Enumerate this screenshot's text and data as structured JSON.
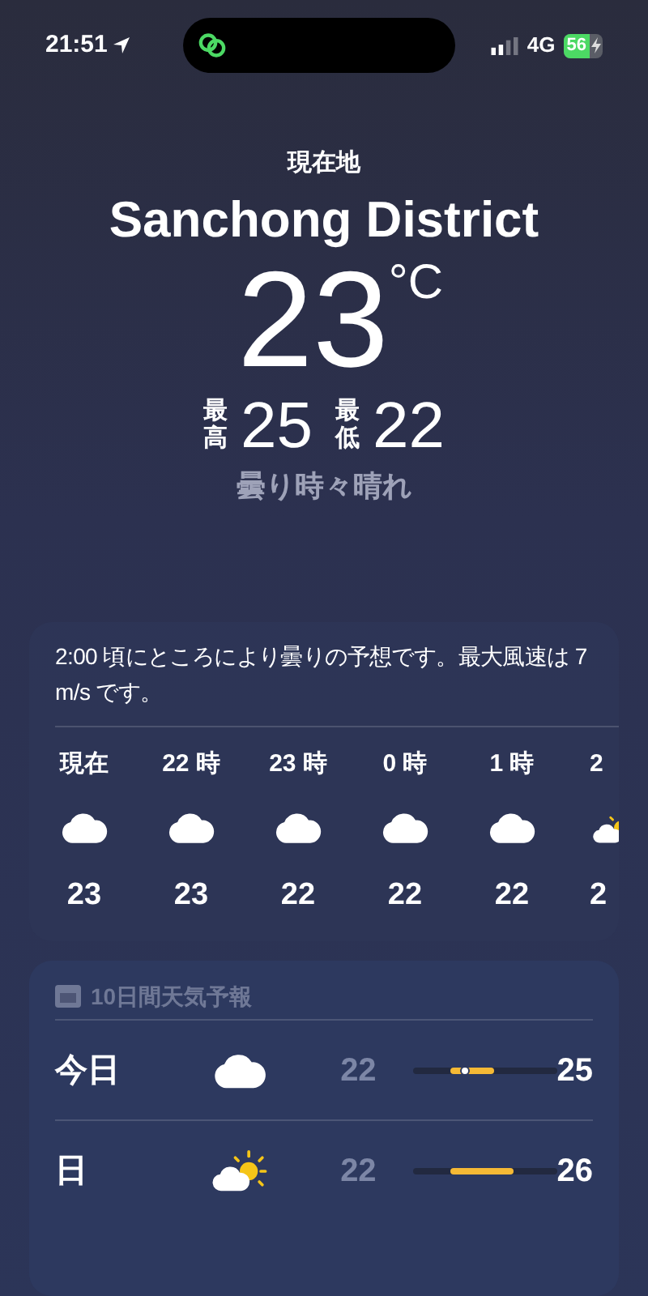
{
  "status_bar": {
    "time": "21:51",
    "network": "4G",
    "battery": "56"
  },
  "header": {
    "location_label": "現在地",
    "city": "Sanchong District",
    "temperature": "23",
    "unit": "°C",
    "high_label": "最高",
    "high": "25",
    "low_label": "最低",
    "low": "22",
    "condition": "曇り時々晴れ"
  },
  "hourly": {
    "summary": "2:00 頃にところにより曇りの予想です。最大風速は 7 m/s です。",
    "hours": [
      {
        "time": "現在",
        "kind": "cloud",
        "temp": "23"
      },
      {
        "time": "22 時",
        "kind": "cloud",
        "temp": "23"
      },
      {
        "time": "23 時",
        "kind": "cloud",
        "temp": "22"
      },
      {
        "time": "0 時",
        "kind": "cloud",
        "temp": "22"
      },
      {
        "time": "1 時",
        "kind": "cloud",
        "temp": "22"
      },
      {
        "time": "2",
        "kind": "partly-sunny",
        "temp": "2"
      }
    ]
  },
  "daily": {
    "title": "10日間天気予報",
    "days": [
      {
        "day": "今日",
        "kind": "cloud",
        "low": "22",
        "high": "25",
        "now": true
      },
      {
        "day": "日",
        "kind": "partly-sunny",
        "low": "22",
        "high": "26",
        "now": false
      }
    ]
  }
}
